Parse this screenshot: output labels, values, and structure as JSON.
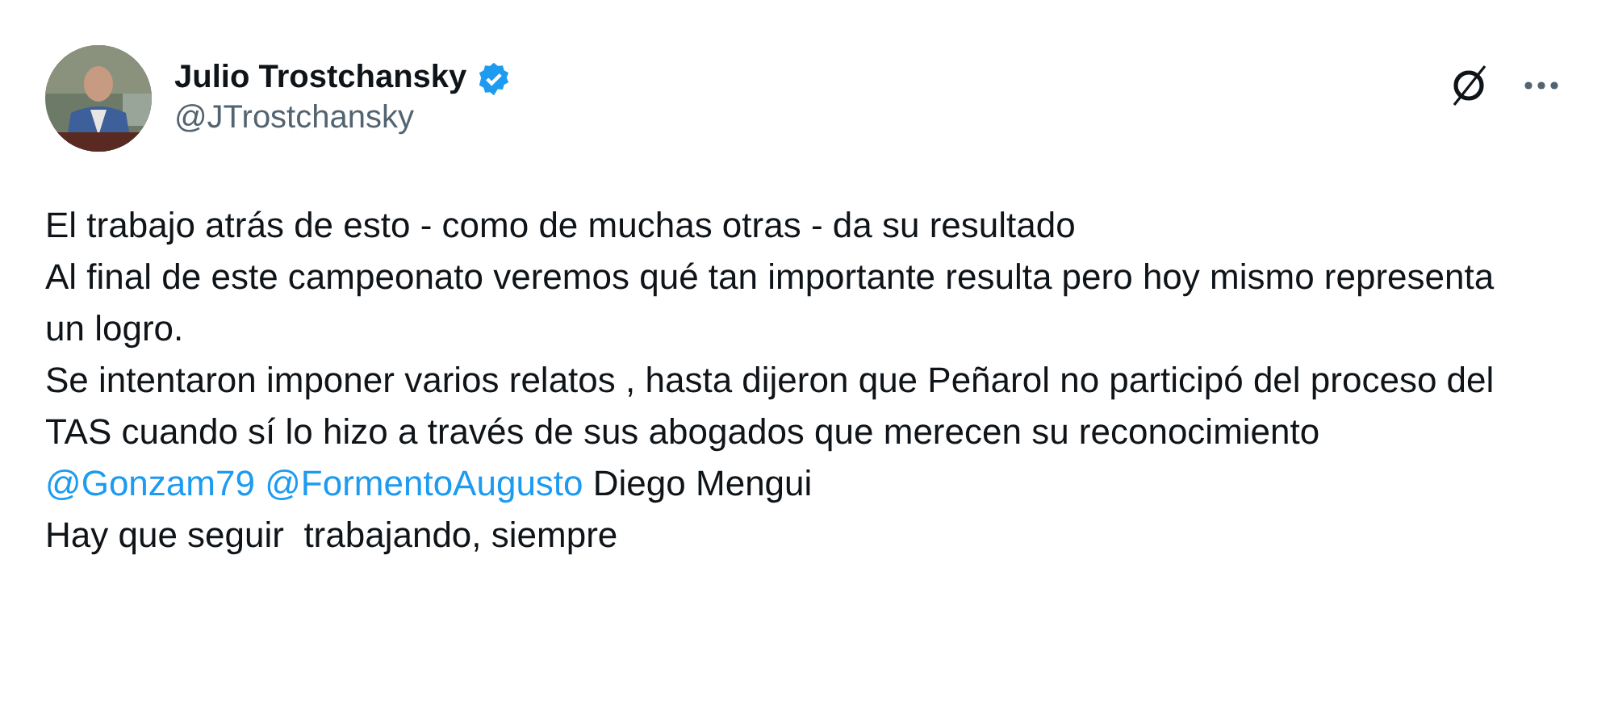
{
  "author": {
    "name": "Julio Trostchansky",
    "verified": true,
    "handle": "@JTrostchansky"
  },
  "paragraphs": [
    [
      {
        "kind": "text",
        "text": "El trabajo atrás de esto - como de muchas otras - da su resultado"
      }
    ],
    [
      {
        "kind": "text",
        "text": "Al final de este campeonato veremos qué tan importante resulta pero hoy mismo representa un logro."
      }
    ],
    [
      {
        "kind": "text",
        "text": "Se intentaron imponer varios relatos , hasta dijeron que Peñarol no participó del proceso del TAS cuando sí lo hizo a través de sus abogados que merecen su reconocimiento "
      },
      {
        "kind": "mention",
        "text": "@Gonzam79"
      },
      {
        "kind": "mention",
        "text": "@FormentoAugusto"
      },
      {
        "kind": "text",
        "text": " Diego Mengui"
      }
    ],
    [
      {
        "kind": "text",
        "text": "Hay que seguir  trabajando, siempre"
      }
    ]
  ]
}
